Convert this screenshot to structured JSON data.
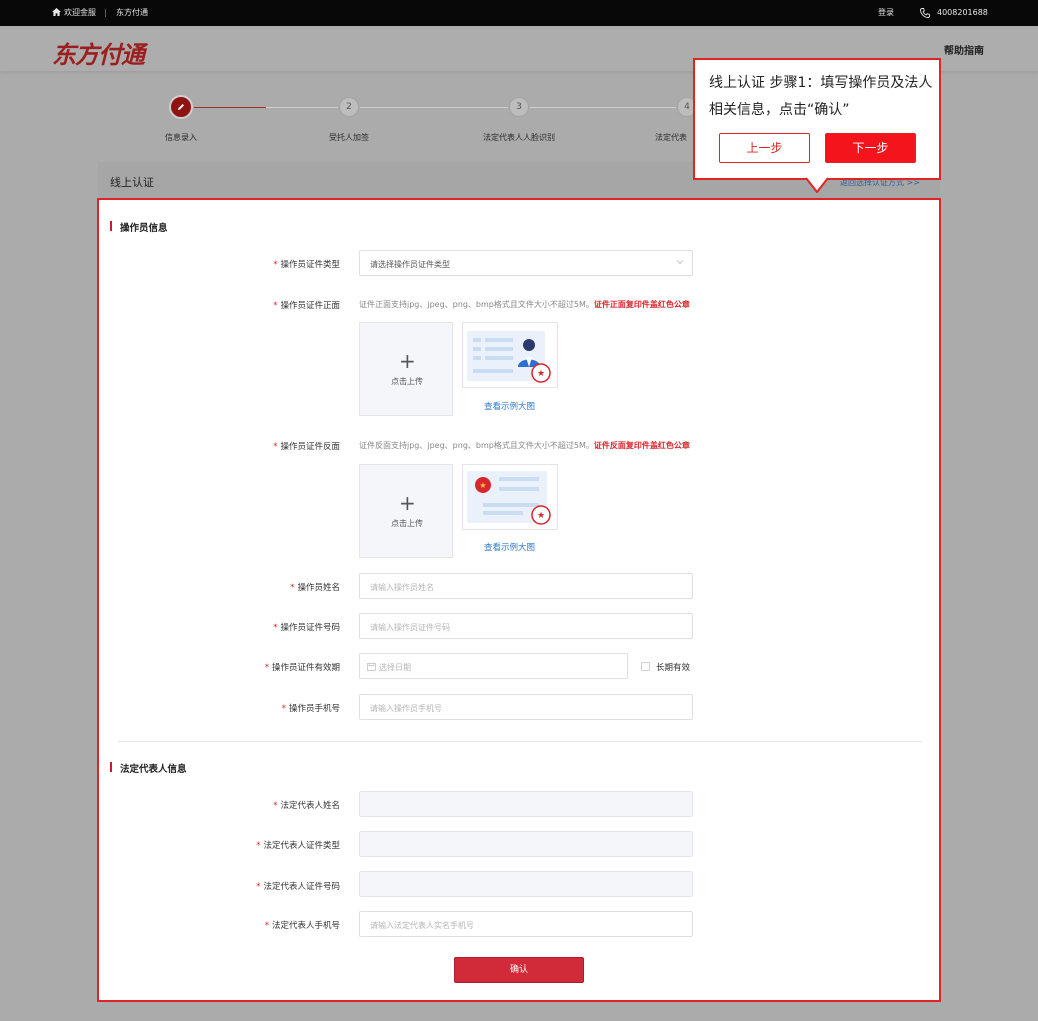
{
  "topbar": {
    "welcome": "欢迎金服",
    "separator": "|",
    "brand": "东方付通",
    "login": "登录",
    "phone": "4008201688"
  },
  "header": {
    "logo": "东方付通",
    "help": "帮助指南"
  },
  "steps": [
    {
      "num": "",
      "label": "信息录入",
      "active": true
    },
    {
      "num": "2",
      "label": "受托人加签",
      "active": false
    },
    {
      "num": "3",
      "label": "法定代表人人脸识别",
      "active": false
    },
    {
      "num": "4",
      "label": "法定代表",
      "active": false
    }
  ],
  "section_bar": {
    "title": "线上认证",
    "link": "返回选择认证方式 >>"
  },
  "operator": {
    "title": "操作员信息",
    "id_type": {
      "label": "操作员证件类型",
      "placeholder": "请选择操作员证件类型"
    },
    "id_front": {
      "label": "操作员证件正面",
      "hint": "证件正面支持jpg、jpeg、png、bmp格式且文件大小不超过5M。",
      "hint_red": "证件正面复印件盖红色公章",
      "upload": "点击上传",
      "sample_link": "查看示例大图"
    },
    "id_back": {
      "label": "操作员证件反面",
      "hint": "证件反面支持jpg、jpeg、png、bmp格式且文件大小不超过5M。",
      "hint_red": "证件反面复印件盖红色公章",
      "upload": "点击上传",
      "sample_link": "查看示例大图"
    },
    "name": {
      "label": "操作员姓名",
      "placeholder": "请输入操作员姓名"
    },
    "id_number": {
      "label": "操作员证件号码",
      "placeholder": "请输入操作员证件号码"
    },
    "validity": {
      "label": "操作员证件有效期",
      "placeholder": "选择日期",
      "long_term": "长期有效"
    },
    "phone": {
      "label": "操作员手机号",
      "placeholder": "请输入操作员手机号"
    }
  },
  "legal": {
    "title": "法定代表人信息",
    "name": {
      "label": "法定代表人姓名"
    },
    "id_type": {
      "label": "法定代表人证件类型"
    },
    "id_number": {
      "label": "法定代表人证件号码"
    },
    "phone": {
      "label": "法定代表人手机号",
      "placeholder": "请输入法定代表人实名手机号"
    }
  },
  "confirm_button": "确认",
  "tooltip": {
    "text": "线上认证  步骤1：填写操作员及法人相关信息，点击“确认”",
    "prev": "上一步",
    "next": "下一步"
  },
  "colors": {
    "accent_red": "#e02424",
    "brand_red": "#9b1f1f",
    "link_blue": "#2b77d0"
  }
}
